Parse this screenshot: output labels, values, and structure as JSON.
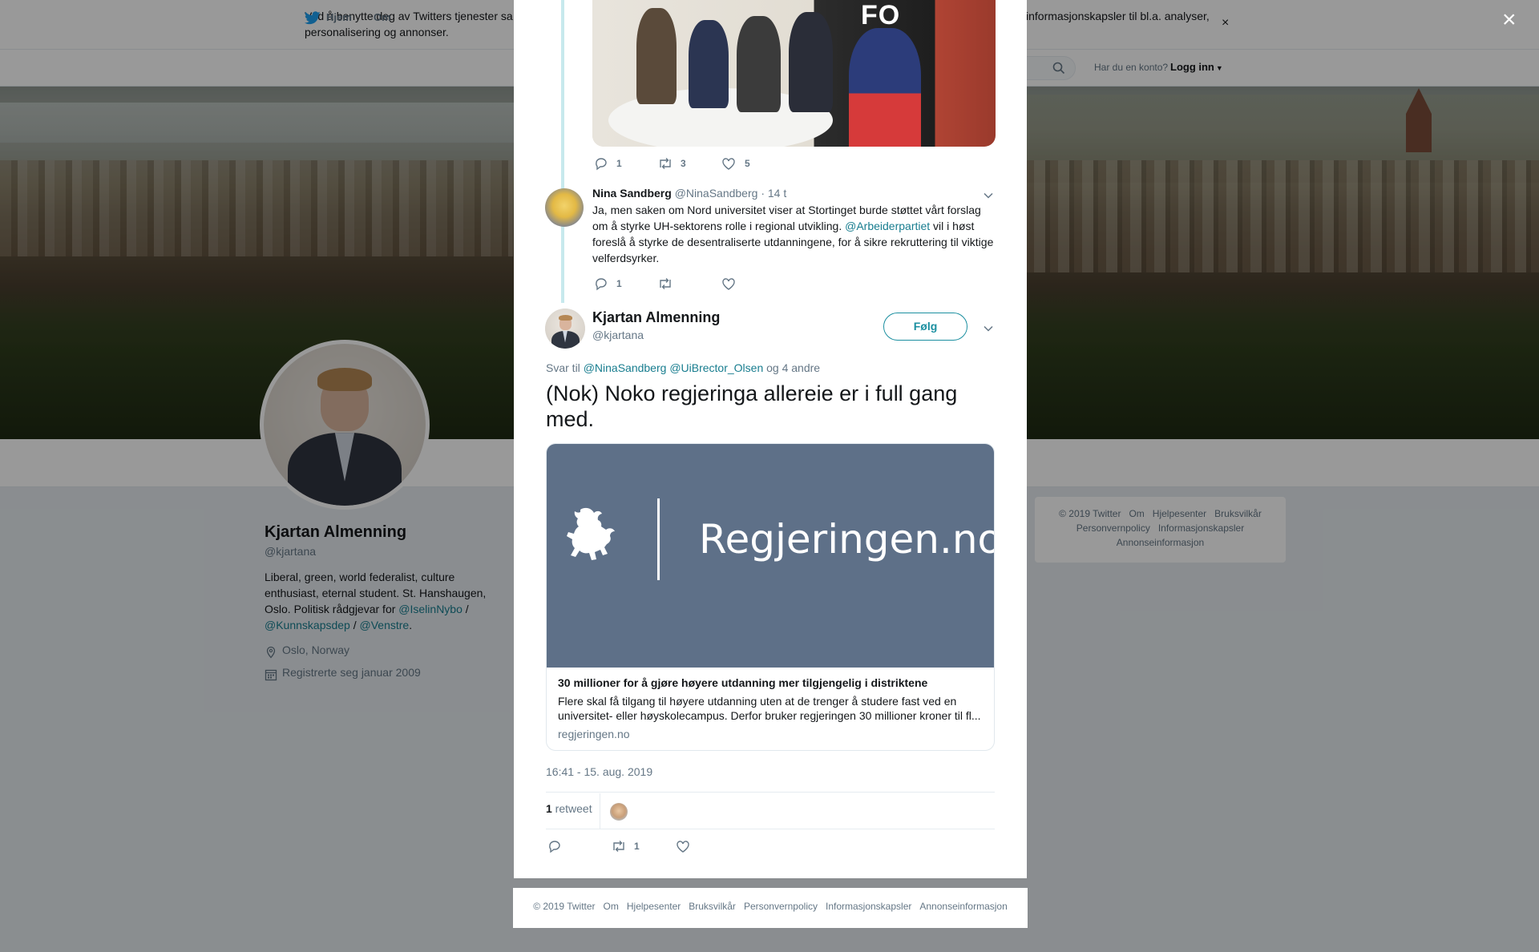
{
  "cookie_banner": {
    "text_left": "Ved å benytte deg av Twitters tjenester sa",
    "text_right": "informasjonskapsler til bl.a. analyser,",
    "text_line2": "personalisering og annonser.",
    "close_label": "×"
  },
  "nav": {
    "home_label": "Hjem",
    "about_label": "Om",
    "account_question": "Har du en konto?",
    "login_label": "Logg inn"
  },
  "profile": {
    "name": "Kjartan Almenning",
    "handle": "@kjartana",
    "bio_part1": "Liberal, green, world federalist, culture enthusiast, eternal student. St. Hanshaugen, Oslo. Politisk rådgjevar for ",
    "bio_link1": "@IselinNybo",
    "bio_sep1": " / ",
    "bio_link2": "@Kunnskapsdep",
    "bio_sep2": " / ",
    "bio_link3": "@Venstre",
    "bio_end": ".",
    "location": "Oslo, Norway",
    "joined": "Registrerte seg januar 2009"
  },
  "side_footer": {
    "items": [
      "© 2019 Twitter",
      "Om",
      "Hjelpesenter",
      "Bruksvilkår",
      "Personvernpolicy",
      "Informasjonskapsler",
      "Annonseinformasjon"
    ]
  },
  "modal": {
    "close_label": "×",
    "tweet1": {
      "photo_text": "FO",
      "replies": "1",
      "retweets": "3",
      "likes": "5"
    },
    "tweet2": {
      "name": "Nina Sandberg",
      "handle": "@NinaSandberg",
      "time": "· 14 t",
      "text_part1": "Ja, men saken om Nord universitet viser at Stortinget burde støttet vårt forslag om å styrke UH-sektorens rolle i regional utvikling. ",
      "mention": "@Arbeiderpartiet",
      "text_part2": " vil i høst foreslå å styrke de desentraliserte utdanningene, for å sikre rekruttering til viktige velferdsyrker.",
      "replies": "1",
      "retweets": "",
      "likes": ""
    },
    "tweet3": {
      "name": "Kjartan Almenning",
      "handle": "@kjartana",
      "follow_label": "Følg",
      "reply_prefix": "Svar til ",
      "reply_mention1": "@NinaSandberg",
      "reply_mention2": "@UiBrector_Olsen",
      "reply_suffix": " og 4 andre",
      "text": "(Nok) Noko regjeringa allereie er i full gang med.",
      "card": {
        "brand": "Regjeringen.no",
        "title": "30 millioner for å gjøre høyere utdanning mer tilgjengelig i distriktene",
        "description": "Flere skal få tilgang til høyere utdanning uten at de trenger å studere fast ved en universitet- eller høyskolecampus. Derfor bruker regjeringen 30 millioner kroner til fl...",
        "domain": "regjeringen.no"
      },
      "timestamp": "16:41 - 15. aug. 2019",
      "retweet_count": "1",
      "retweet_label": " retweet",
      "replies": "",
      "retweets": "1",
      "likes": ""
    }
  },
  "modal_footer": {
    "items": [
      "© 2019 Twitter",
      "Om",
      "Hjelpesenter",
      "Bruksvilkår",
      "Personvernpolicy",
      "Informasjonskapsler",
      "Annonseinformasjon"
    ]
  },
  "colors": {
    "accent": "#1b8fa0",
    "link": "#187d8f",
    "muted": "#657786",
    "card_bg": "#5e7088"
  },
  "icons": [
    "twitter-bird-icon",
    "search-icon",
    "location-icon",
    "calendar-icon",
    "reply-icon",
    "retweet-icon",
    "like-icon",
    "chevron-down-icon",
    "close-icon",
    "lion-crest-icon"
  ]
}
